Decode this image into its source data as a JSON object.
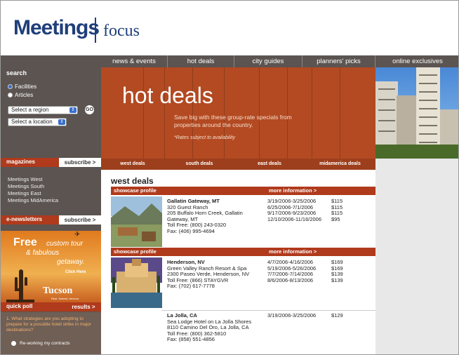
{
  "header": {
    "logo_main": "Meetings",
    "logo_sub": "focus"
  },
  "nav": {
    "items": [
      "news & events",
      "hot deals",
      "city guides",
      "planners' picks",
      "online exclusives"
    ]
  },
  "sidebar": {
    "search_title": "search",
    "radios": [
      {
        "label": "Facilities",
        "selected": true
      },
      {
        "label": "Articles",
        "selected": false
      }
    ],
    "region_select": "Select a region",
    "location_select": "Select a location",
    "go_label": "GO",
    "magazines": {
      "title": "magazines",
      "action": "subscribe >",
      "items": [
        "Meetings West",
        "Meetings South",
        "Meetings East",
        "Meetings MidAmerica"
      ]
    },
    "enewsletters": {
      "title": "e-newsletters",
      "action": "subscribe >"
    },
    "ad": {
      "free": "Free",
      "line1": "custom tour",
      "line2": "& fabulous",
      "line3": "getaway.",
      "click": "Click Here",
      "brand": "Tucson",
      "tagline": "Real. Natural. Arizona."
    },
    "poll": {
      "title": "quick poll",
      "action": "results >",
      "question": "1. What strategies are you adopting to prepare for a possible hotel strike in major destinations?",
      "options": [
        "Re-working my contracts"
      ]
    }
  },
  "hero": {
    "title": "hot deals",
    "description": "Save big with these group-rate specials from properties around the country.",
    "note": "*Rates subject to availability"
  },
  "regions": [
    "west deals",
    "south deals",
    "east deals",
    "midamerica deals"
  ],
  "content": {
    "section_title": "west deals",
    "showcase_label": "showcase profile",
    "more_info_label": "more information >",
    "listings": [
      {
        "name": "Gallatin Gateway, MT",
        "lines": [
          "320 Guest Ranch",
          "205 Buffalo Horn Creek, Gallatin",
          "Gateway, MT",
          "Toll Free: (800) 243-0320",
          "Fax: (406) 995-4694"
        ],
        "dates": [
          "3/19/2006-3/25/2006",
          "6/25/2006-7/1/2006",
          "9/17/2006-9/23/2006",
          "12/10/2006-11/16/2006"
        ],
        "prices": [
          "$115",
          "$115",
          "$115",
          "$95"
        ]
      },
      {
        "name": "Henderson, NV",
        "lines": [
          "Green Valley Ranch Resort & Spa",
          "2300 Paseo Verde, Henderson, NV",
          "Toll Free: (866) STAYGVR",
          "Fax: (702) 617-7778"
        ],
        "dates": [
          "4/7/2006-4/16/2006",
          "5/19/2006-5/26/2006",
          "7/7/2006-7/14/2006",
          "8/6/2006-8/13/2006"
        ],
        "prices": [
          "$169",
          "$169",
          "$139",
          "$139"
        ]
      },
      {
        "name": "La Jolla, CA",
        "lines": [
          "Sea Lodge Hotel on La Jolla Shores",
          "8110 Camino Del Oro, La Jolla, CA",
          "Toll Free: (800) 362-5810",
          "Fax: (858) 551-4856"
        ],
        "dates": [
          "3/19/2006-3/25/2006"
        ],
        "prices": [
          "$129"
        ]
      }
    ]
  }
}
